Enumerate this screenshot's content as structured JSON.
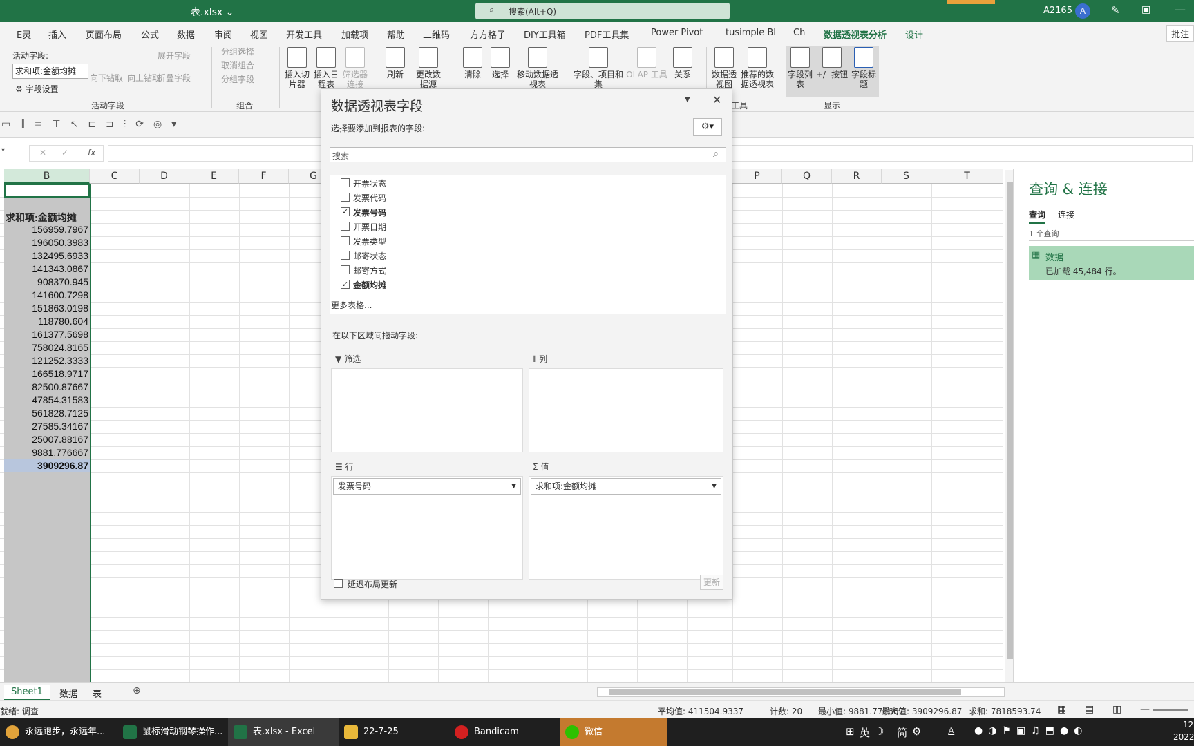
{
  "titlebar": {
    "filename": "表.xlsx ⌄",
    "search": "搜索(Alt+Q)",
    "user": "A2165",
    "avatar": "A"
  },
  "menu": [
    "E灵",
    "插入",
    "页面布局",
    "公式",
    "数据",
    "审阅",
    "视图",
    "开发工具",
    "加载项",
    "帮助",
    "二维码",
    "方方格子",
    "DIY工具箱",
    "PDF工具集",
    "Power Pivot",
    "tusimple BI",
    "Ch",
    "数据透视表分析",
    "设计"
  ],
  "menu_right": "批注",
  "ribbon": {
    "active_field_label": "活动字段:",
    "active_field_value": "求和项:金额均摊",
    "field_settings": "字段设置",
    "drill_down": "向下钻取",
    "drill_up": "向上钻取",
    "expand": "展开字段",
    "collapse": "折叠字段",
    "group_active": "活动字段",
    "group_select": "分组选择",
    "ungroup": "取消组合",
    "group_field": "分组字段",
    "group_group": "组合",
    "insert_slicer": "插入切片器",
    "insert_timeline": "插入日程表",
    "filter_conn": "筛选器连接",
    "refresh": "刷新",
    "change_source": "更改数据源",
    "clear": "清除",
    "select": "选择",
    "move": "移动数据透视表",
    "fields_items": "字段、项目和集",
    "olap": "OLAP 工具",
    "relations": "关系",
    "pivot_chart": "数据透视图",
    "recommended": "推荐的数据透视表",
    "tools": "工具",
    "field_list": "字段列表",
    "buttons": "+/- 按钮",
    "headers": "字段标题",
    "show": "显示"
  },
  "formula": {
    "fx": "fx",
    "cancel": "✕",
    "confirm": "✓"
  },
  "columns": [
    "B",
    "C",
    "D",
    "E",
    "F",
    "G",
    "P",
    "Q",
    "R",
    "S",
    "T"
  ],
  "pivot": {
    "header": "求和项:金额均摊",
    "values": [
      "156959.7967",
      "196050.3983",
      "132495.6933",
      "141343.0867",
      "908370.945",
      "141600.7298",
      "151863.0198",
      "118780.604",
      "161377.5698",
      "758024.8165",
      "121252.3333",
      "166518.9717",
      "82500.87667",
      "47854.31583",
      "561828.7125",
      "27585.34167",
      "25007.88167",
      "9881.776667"
    ],
    "total": "3909296.87"
  },
  "pane": {
    "title": "数据透视表字段",
    "subtitle": "选择要添加到报表的字段:",
    "search_placeholder": "搜索",
    "fields": [
      {
        "label": "开票状态",
        "checked": false
      },
      {
        "label": "发票代码",
        "checked": false
      },
      {
        "label": "发票号码",
        "checked": true
      },
      {
        "label": "开票日期",
        "checked": false
      },
      {
        "label": "发票类型",
        "checked": false
      },
      {
        "label": "邮寄状态",
        "checked": false
      },
      {
        "label": "邮寄方式",
        "checked": false
      },
      {
        "label": "金额均摊",
        "checked": true
      }
    ],
    "more": "更多表格...",
    "drag_hint": "在以下区域间拖动字段:",
    "filter": "筛选",
    "columns": "列",
    "rows": "行",
    "values": "值",
    "row_field": "发票号码",
    "value_field": "求和项:金额均摊",
    "defer": "延迟布局更新",
    "update": "更新"
  },
  "query": {
    "title": "查询 & 连接",
    "tab_query": "查询",
    "tab_conn": "连接",
    "count": "1 个查询",
    "item_name": "数据",
    "item_status": "已加载 45,484 行。"
  },
  "sheets": [
    "Sheet1",
    "数据",
    "表"
  ],
  "status": {
    "mode": "就绪: 调查",
    "average": "平均值: 411504.9337",
    "count": "计数: 20",
    "min": "最小值: 9881.776667",
    "max": "最大值: 3909296.87",
    "sum": "求和: 7818593.74"
  },
  "taskbar": {
    "items": [
      "永远跑步，永远年...",
      "鼠标滑动钢琴操作...",
      "表.xlsx - Excel",
      "22-7-25",
      "Bandicam",
      "微信"
    ],
    "tray": "英",
    "tray2": "简",
    "time": "12",
    "date": "2022"
  },
  "colors": {
    "accent": "#217346",
    "selection": "#c6c6c6",
    "query_item": "#a9d8b8"
  }
}
